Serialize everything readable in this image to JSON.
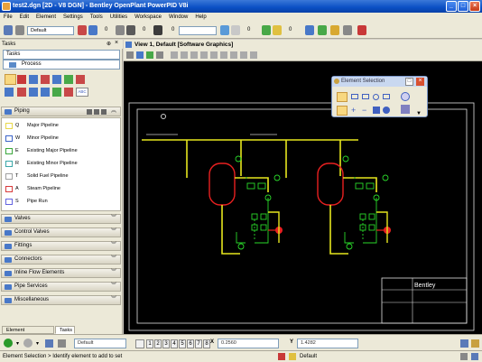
{
  "window": {
    "title": "test2.dgn [2D - V8 DGN] - Bentley OpenPlant PowerPID V8i"
  },
  "menu": [
    "File",
    "Edit",
    "Element",
    "Settings",
    "Tools",
    "Utilities",
    "Workspace",
    "Window",
    "Help"
  ],
  "toolbar": {
    "level_select": "Default",
    "num1": "0",
    "num2": "0",
    "num3": "0",
    "num4": "0",
    "num5": "0"
  },
  "tasks": {
    "header": "Tasks",
    "selector_label": "Tasks",
    "process_label": "Process",
    "piping_header": "Piping",
    "piping_items": [
      {
        "letter": "Q",
        "label": "Major Pipeline",
        "color": "#e8d84a"
      },
      {
        "letter": "W",
        "label": "Minor Pipeline",
        "color": "#3c64c8"
      },
      {
        "letter": "E",
        "label": "Existing Major Pipeline",
        "color": "#3ca83c"
      },
      {
        "letter": "R",
        "label": "Existing Minor Pipeline",
        "color": "#3ca8a8"
      },
      {
        "letter": "T",
        "label": "Solid Fuel Pipeline",
        "color": "#a0a0a0"
      },
      {
        "letter": "A",
        "label": "Steam Pipeline",
        "color": "#d83c3c"
      },
      {
        "letter": "S",
        "label": "Pipe Run",
        "color": "#6464e0"
      }
    ],
    "sections": [
      "Valves",
      "Control Valves",
      "Fittings",
      "Connectors",
      "Inline Flow Elements",
      "Pipe Services",
      "Miscellaneous"
    ]
  },
  "tabs": {
    "element_info": "Element Information",
    "tasks": "Tasks"
  },
  "view": {
    "title": "View 1, Default [Software Graphics]",
    "logo_text": "Bentley"
  },
  "element_selection": {
    "title": "Element Selection"
  },
  "statusbar": {
    "level": "Default",
    "pages": [
      "1",
      "2",
      "3",
      "4",
      "5",
      "6",
      "7",
      "8"
    ],
    "x_label": "X",
    "x_value": "0.2560",
    "y_label": "Y",
    "y_value": "1.4282",
    "prompt": "Element Selection > Identify element to add to set",
    "level_status": "Default"
  },
  "colors": {
    "major_pipeline": "#e6e61e",
    "minor_pipeline": "#2ad82a",
    "vessel": "#e82020",
    "accent": "#0a4fc4"
  }
}
